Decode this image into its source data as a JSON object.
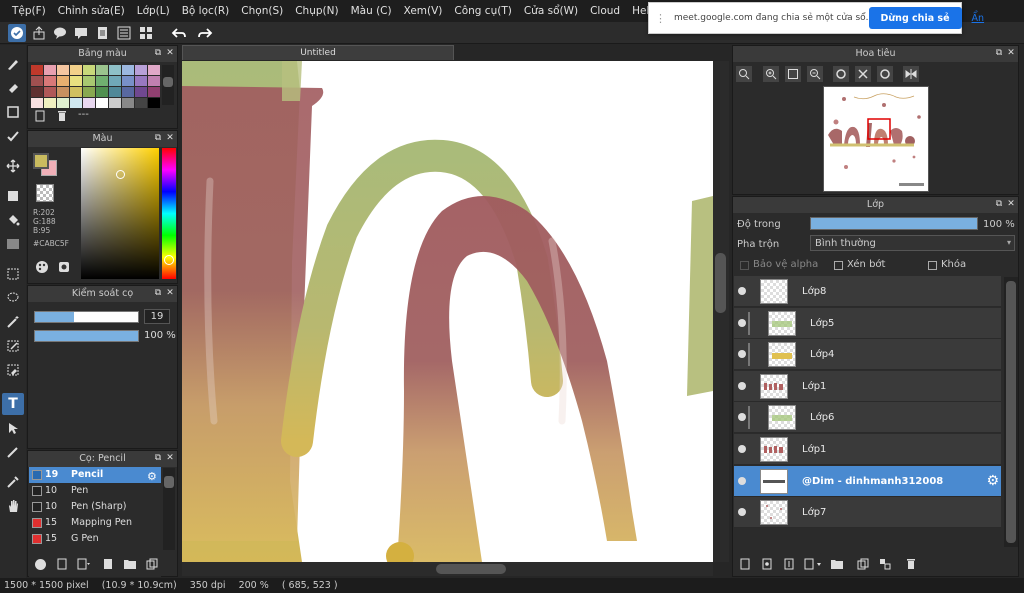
{
  "menu": [
    "Tệp(F)",
    "Chỉnh sửa(E)",
    "Lớp(L)",
    "Bộ lọc(R)",
    "Chọn(S)",
    "Chụp(N)",
    "Màu (C)",
    "Xem(V)",
    "Công cụ(T)",
    "Cửa sổ(W)",
    "Cloud",
    "Help"
  ],
  "share_bar": {
    "message": "meet.google.com đang chia sẻ một cửa sổ.",
    "stop_label": "Dừng chia sẻ",
    "hide_label": "Ẩn"
  },
  "palette_panel": {
    "title": "Bảng màu",
    "dash": "---"
  },
  "palette_colors": [
    "#c0392b",
    "#e8a0b0",
    "#f5c6a0",
    "#f2d08a",
    "#c8d87a",
    "#9bc48e",
    "#8ec0c8",
    "#9cb8e0",
    "#b8a0d8",
    "#e0a8c8",
    "#a05050",
    "#d87878",
    "#e8b070",
    "#e8e080",
    "#a8c870",
    "#70b070",
    "#70a8b8",
    "#7890c8",
    "#9878c0",
    "#c080b0",
    "#603030",
    "#b05858",
    "#c89060",
    "#d0c060",
    "#88a850",
    "#509050",
    "#508898",
    "#5868a0",
    "#704890",
    "#904070",
    "#f8e0e0",
    "#f0f0c0",
    "#e0f0d0",
    "#d0e8f0",
    "#e8d8f0",
    "#ffffff",
    "#cccccc",
    "#888888",
    "#444444",
    "#000000"
  ],
  "color_panel": {
    "title": "Màu",
    "r": "R:202",
    "g": "G:188",
    "b": "B:95",
    "hex": "#CABC5F",
    "primary": "#CABC5F",
    "secondary": "#f0b0b8"
  },
  "brush_control": {
    "title": "Kiểm soát cọ",
    "size": "19",
    "size_fraction": 0.38,
    "opacity": "100 %",
    "opacity_fraction": 1.0
  },
  "brush_panel": {
    "title": "Cọ: Pencil",
    "items": [
      {
        "size": "19",
        "name": "Pencil",
        "color": "#2a6ab0",
        "selected": true
      },
      {
        "size": "10",
        "name": "Pen",
        "color": "#222222",
        "selected": false
      },
      {
        "size": "10",
        "name": "Pen (Sharp)",
        "color": "#222222",
        "selected": false
      },
      {
        "size": "15",
        "name": "Mapping Pen",
        "color": "#e03030",
        "selected": false
      },
      {
        "size": "15",
        "name": "G Pen",
        "color": "#e03030",
        "selected": false
      }
    ]
  },
  "canvas": {
    "tab": "Untitled"
  },
  "navigator": {
    "title": "Hoa tiêu"
  },
  "layer_panel": {
    "title": "Lớp",
    "opacity_label": "Độ trong",
    "opacity_value": "100 %",
    "opacity_fraction": 1.0,
    "blend_label": "Pha trộn",
    "blend_value": "Bình thường",
    "protect_alpha": "Bảo vệ alpha",
    "clipping": "Xén bớt",
    "lock": "Khóa",
    "layers": [
      {
        "name": "Lớp8",
        "clipped": false,
        "selected": false,
        "thumb": "empty"
      },
      {
        "name": "Lớp5",
        "clipped": true,
        "selected": false,
        "thumb": "green"
      },
      {
        "name": "Lớp4",
        "clipped": true,
        "selected": false,
        "thumb": "yellow"
      },
      {
        "name": "Lớp1",
        "clipped": false,
        "selected": false,
        "thumb": "red"
      },
      {
        "name": "Lớp6",
        "clipped": true,
        "selected": false,
        "thumb": "green"
      },
      {
        "name": "Lớp1",
        "clipped": false,
        "selected": false,
        "thumb": "red"
      },
      {
        "name": "@Dim - dinhmanh312008",
        "clipped": false,
        "selected": true,
        "thumb": "text"
      },
      {
        "name": "Lớp7",
        "clipped": false,
        "selected": false,
        "thumb": "dots"
      }
    ]
  },
  "status": {
    "size": "1500 * 1500 pixel",
    "cm": "(10.9 * 10.9cm)",
    "dpi": "350 dpi",
    "zoom": "200 %",
    "coords": "( 685, 523 )"
  }
}
